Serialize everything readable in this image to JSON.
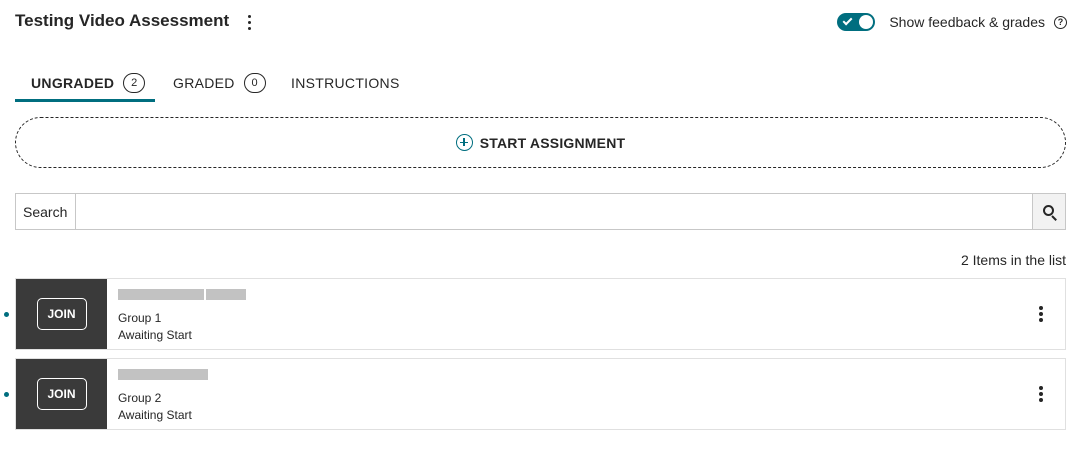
{
  "header": {
    "title": "Testing Video Assessment",
    "toggle_label": "Show feedback & grades",
    "toggle_on": true,
    "help_icon_glyph": "?"
  },
  "tabs": [
    {
      "label": "UNGRADED",
      "count": "2",
      "active": true
    },
    {
      "label": "GRADED",
      "count": "0",
      "active": false
    },
    {
      "label": "INSTRUCTIONS",
      "active": false
    }
  ],
  "start_button": {
    "label": "START ASSIGNMENT",
    "icon": "plus-circle-icon"
  },
  "search": {
    "label": "Search",
    "value": "",
    "placeholder": "",
    "icon": "search-icon"
  },
  "list": {
    "count_text": "2 Items in the list",
    "items": [
      {
        "join_label": "JOIN",
        "group": "Group 1",
        "status": "Awaiting Start"
      },
      {
        "join_label": "JOIN",
        "group": "Group 2",
        "status": "Awaiting Start"
      }
    ]
  },
  "colors": {
    "accent": "#006e7f",
    "join_panel": "#3a3a3a",
    "text": "#262626"
  }
}
